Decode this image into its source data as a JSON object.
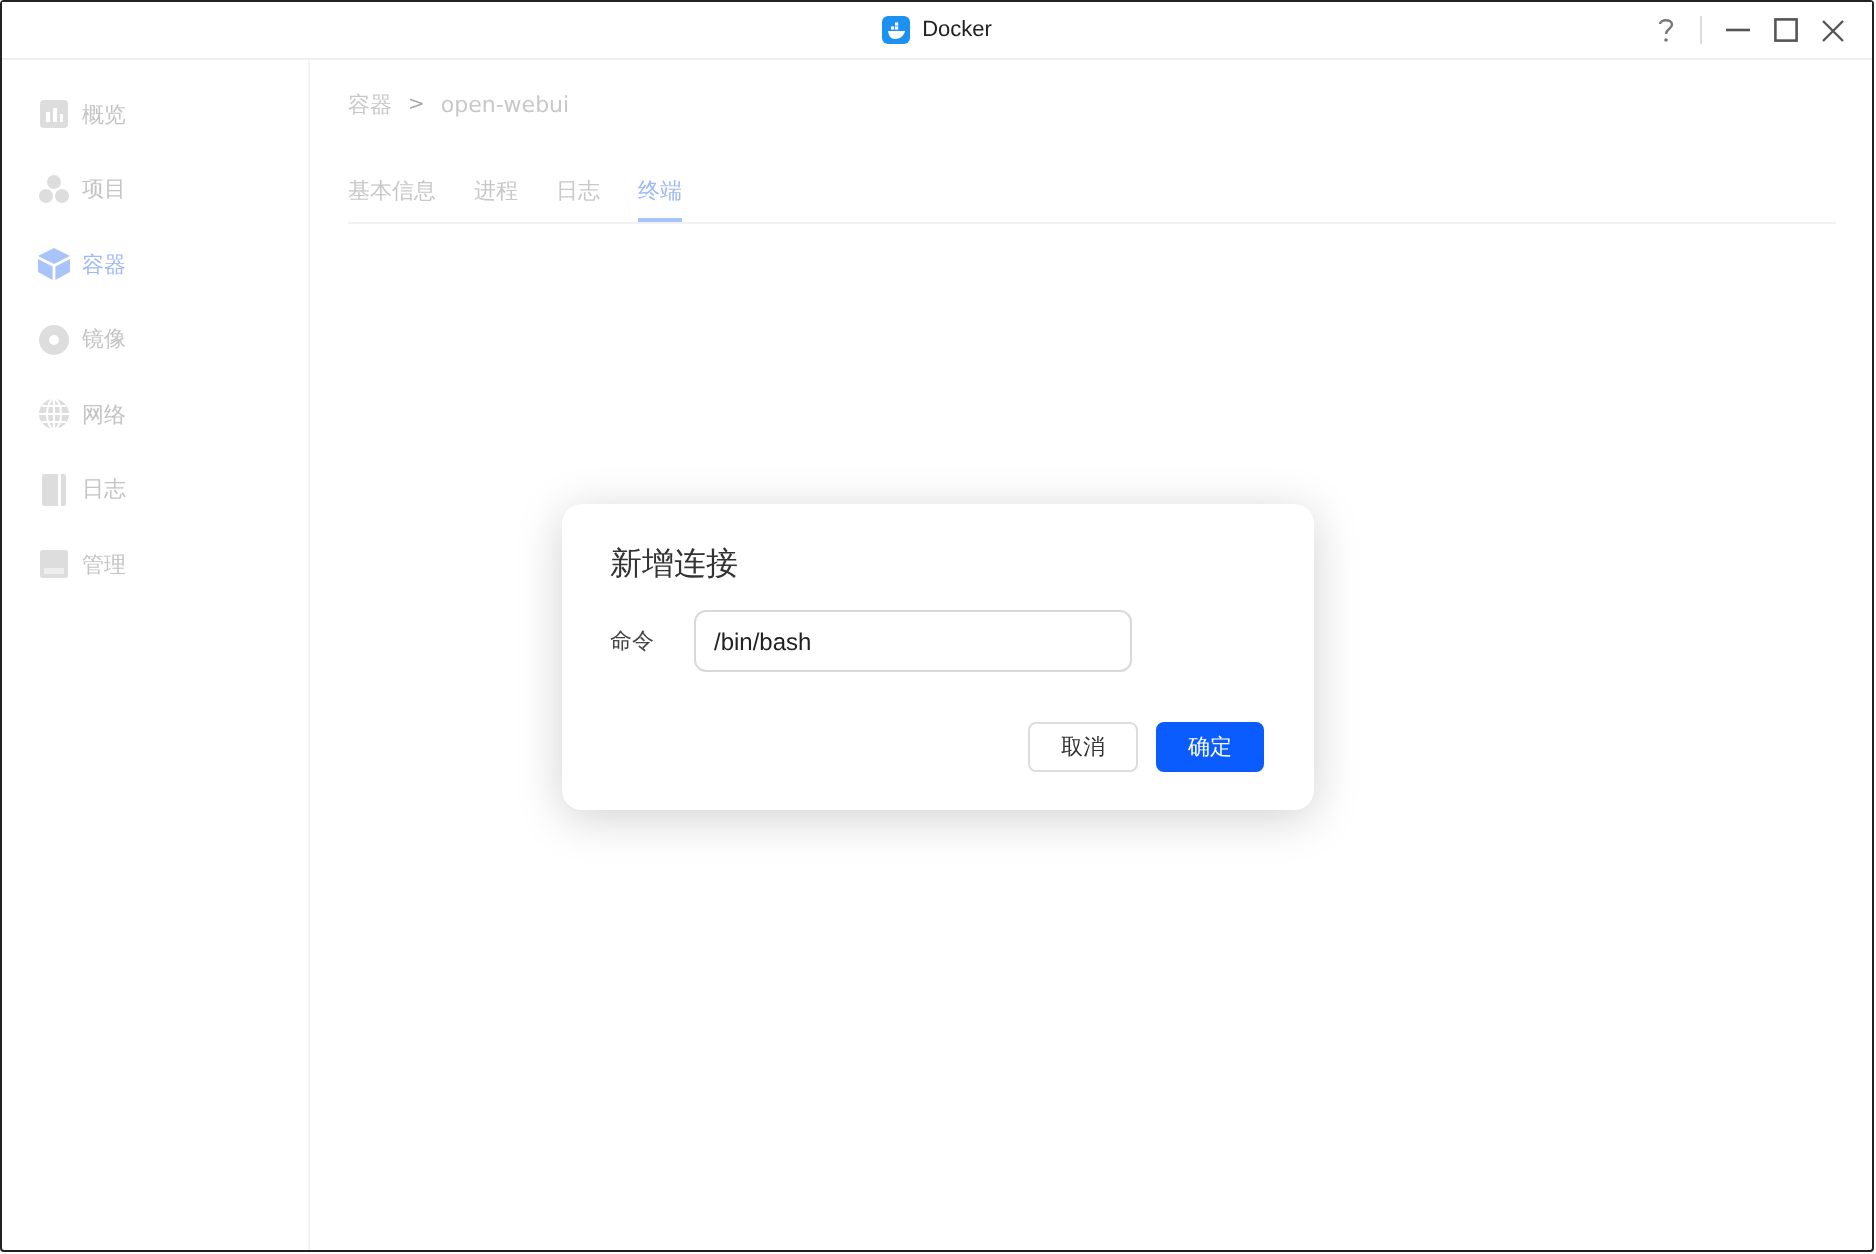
{
  "window": {
    "title": "Docker"
  },
  "sidebar": {
    "items": [
      {
        "label": "概览",
        "selected": false
      },
      {
        "label": "项目",
        "selected": false
      },
      {
        "label": "容器",
        "selected": true
      },
      {
        "label": "镜像",
        "selected": false
      },
      {
        "label": "网络",
        "selected": false
      },
      {
        "label": "日志",
        "selected": false
      },
      {
        "label": "管理",
        "selected": false
      }
    ]
  },
  "breadcrumb": [
    {
      "label": "容器"
    },
    {
      "label": ">",
      "kind": "separator"
    },
    {
      "label": "open-webui"
    }
  ],
  "tabs": [
    {
      "label": "基本信息",
      "selected": false
    },
    {
      "label": "进程",
      "selected": false
    },
    {
      "label": "日志",
      "selected": false
    },
    {
      "label": "终端",
      "selected": true
    }
  ],
  "dialog": {
    "title": "新增连接",
    "field": {
      "label": "命令",
      "value": "/bin/bash"
    },
    "buttons": [
      {
        "label": "取消",
        "kind": "secondary"
      },
      {
        "label": "确定",
        "kind": "primary"
      }
    ]
  }
}
